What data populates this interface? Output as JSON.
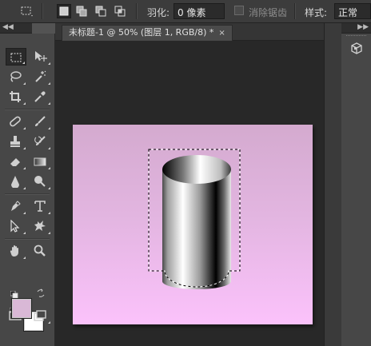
{
  "options_bar": {
    "feather_label": "羽化:",
    "feather_value": "0 像素",
    "antialias_label": "消除锯齿",
    "style_label": "样式:",
    "style_value": "正常"
  },
  "document": {
    "tab_title": "未标题-1 @ 50% (图层 1, RGB/8) *",
    "close_glyph": "×"
  },
  "panel_collapse_glyph": "◀◀",
  "colors": {
    "foreground": "#d9b8d6",
    "background": "#ffffff",
    "canvas_top": "#d4aacf",
    "canvas_bottom": "#fbc2fb"
  },
  "tools": [
    "rectangular-marquee-tool",
    "move-tool",
    "lasso-tool",
    "magic-wand-tool",
    "crop-tool",
    "eyedropper-tool",
    "spot-healing-brush-tool",
    "brush-tool",
    "clone-stamp-tool",
    "history-brush-tool",
    "eraser-tool",
    "gradient-tool",
    "blur-tool",
    "dodge-tool",
    "pen-tool",
    "type-tool",
    "path-selection-tool",
    "custom-shape-tool",
    "hand-tool",
    "zoom-tool"
  ]
}
